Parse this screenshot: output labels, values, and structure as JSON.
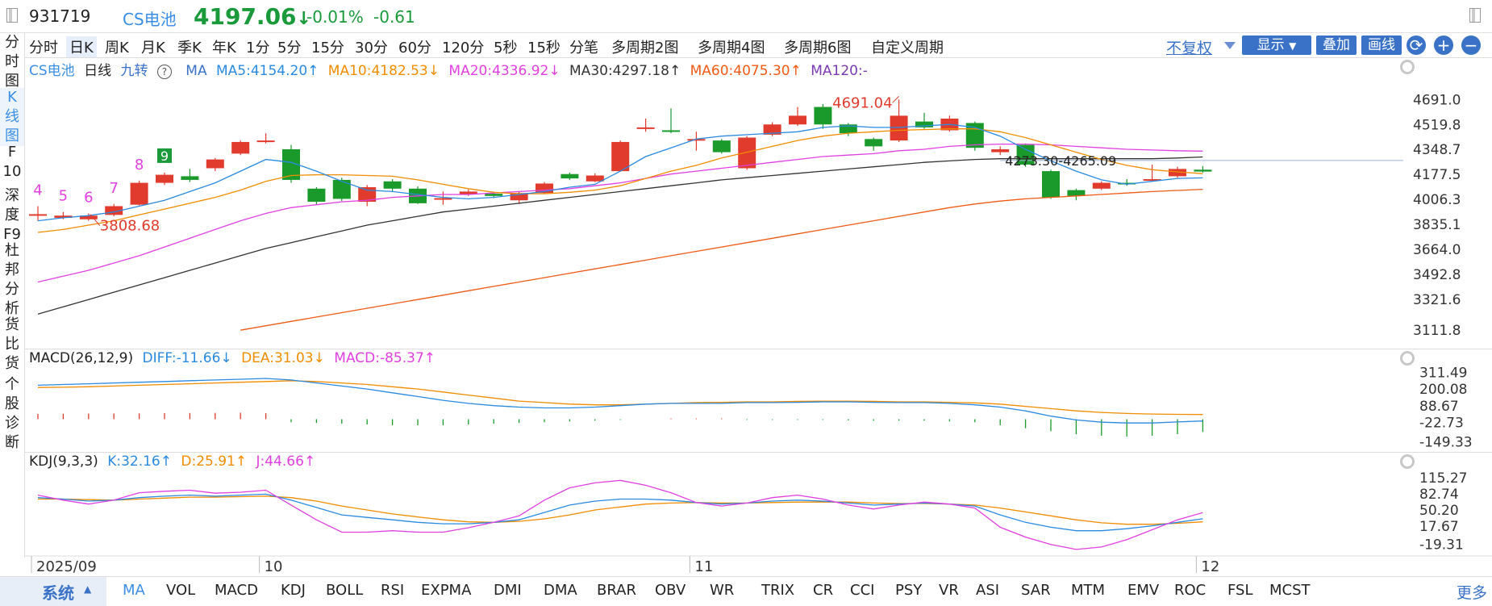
{
  "header": {
    "code": "931719",
    "name": "CS电池",
    "price": "4197.06",
    "change_pct": "-0.01%",
    "change_abs": "-0.61"
  },
  "left_nav": [
    {
      "label": "分时图",
      "active": false
    },
    {
      "label": "K线图",
      "active": true
    },
    {
      "label": "F10",
      "active": false
    },
    {
      "label": "深度F9",
      "active": false
    },
    {
      "label": "杜邦分析",
      "active": false
    },
    {
      "label": "货比货",
      "active": false
    },
    {
      "label": "个股诊断",
      "active": false
    }
  ],
  "periods": [
    "分时",
    "日K",
    "周K",
    "月K",
    "季K",
    "年K",
    "1分",
    "5分",
    "15分",
    "30分",
    "60分",
    "120分",
    "5秒",
    "15秒",
    "分笔",
    "多周期2图",
    "多周期4图",
    "多周期6图",
    "自定义周期"
  ],
  "active_period": "日K",
  "toolbar": {
    "adjust": "不复权",
    "display": "显示",
    "overlay": "叠加",
    "draw": "画线",
    "refresh_icon": "refresh-icon",
    "zoom_in": "+",
    "zoom_out": "−"
  },
  "main_legend": {
    "name": "CS电池",
    "period": "日线",
    "nine": "九转",
    "ma": "MA",
    "ma5": "MA5:4154.20↑",
    "ma10": "MA10:4182.53↓",
    "ma20": "MA20:4336.92↓",
    "ma30": "MA30:4297.18↑",
    "ma60": "MA60:4075.30↑",
    "ma120": "MA120:-"
  },
  "macd_legend": {
    "title": "MACD(26,12,9)",
    "diff": "DIFF:-11.66↓",
    "dea": "DEA:31.03↓",
    "macd": "MACD:-85.37↑"
  },
  "kdj_legend": {
    "title": "KDJ(9,3,3)",
    "k": "K:32.16↑",
    "d": "D:25.91↑",
    "j": "J:44.66↑"
  },
  "x_labels": [
    {
      "label": "2025/09",
      "index": 0
    },
    {
      "label": "10",
      "index": 9
    },
    {
      "label": "11",
      "index": 26
    },
    {
      "label": "12",
      "index": 46
    }
  ],
  "colors": {
    "up": "#e03b2c",
    "down": "#1a9a2a",
    "ma5": "#2a8ae0",
    "ma10": "#f08c00",
    "ma20": "#e040e0",
    "ma30": "#333333",
    "ma60": "#f05a14"
  },
  "chart_data": {
    "type": "candlestick",
    "main_y_ticks": [
      4691.0,
      4519.8,
      4348.7,
      4177.5,
      4006.3,
      3835.1,
      3664.0,
      3492.8,
      3321.6,
      3111.8
    ],
    "main_ylim": [
      3050,
      4820
    ],
    "candles": [
      [
        3905,
        3905,
        3960,
        3860
      ],
      [
        3880,
        3895,
        3920,
        3870
      ],
      [
        3870,
        3895,
        3910,
        3860
      ],
      [
        3900,
        3960,
        3975,
        3890
      ],
      [
        3970,
        4120,
        4135,
        3965
      ],
      [
        4120,
        4175,
        4190,
        4105
      ],
      [
        4165,
        4140,
        4215,
        4125
      ],
      [
        4220,
        4280,
        4290,
        4200
      ],
      [
        4320,
        4400,
        4410,
        4310
      ],
      [
        4400,
        4410,
        4460,
        4390
      ],
      [
        4350,
        4140,
        4380,
        4120
      ],
      [
        4080,
        3990,
        4090,
        3970
      ],
      [
        4140,
        4010,
        4155,
        3995
      ],
      [
        3990,
        4090,
        4105,
        3960
      ],
      [
        4130,
        4080,
        4145,
        4060
      ],
      [
        4080,
        3980,
        4095,
        3975
      ],
      [
        4015,
        4015,
        4060,
        3970
      ],
      [
        4040,
        4060,
        4075,
        4030
      ],
      [
        4045,
        4030,
        4060,
        4015
      ],
      [
        4000,
        4050,
        4060,
        3975
      ],
      [
        4050,
        4115,
        4125,
        4045
      ],
      [
        4180,
        4150,
        4190,
        4140
      ],
      [
        4130,
        4170,
        4185,
        4125
      ],
      [
        4200,
        4400,
        4410,
        4195
      ],
      [
        4500,
        4500,
        4560,
        4470
      ],
      [
        4480,
        4470,
        4630,
        4460
      ],
      [
        4420,
        4420,
        4470,
        4340
      ],
      [
        4410,
        4330,
        4420,
        4320
      ],
      [
        4220,
        4430,
        4440,
        4210
      ],
      [
        4450,
        4520,
        4535,
        4440
      ],
      [
        4520,
        4580,
        4640,
        4510
      ],
      [
        4640,
        4520,
        4660,
        4490
      ],
      [
        4520,
        4460,
        4530,
        4440
      ],
      [
        4420,
        4370,
        4430,
        4340
      ],
      [
        4410,
        4580,
        4691.04,
        4400
      ],
      [
        4540,
        4500,
        4600,
        4490
      ],
      [
        4480,
        4560,
        4580,
        4470
      ],
      [
        4530,
        4360,
        4540,
        4340
      ],
      [
        4330,
        4350,
        4370,
        4310
      ],
      [
        4380,
        4245,
        4390,
        4230
      ],
      [
        4200,
        4020,
        4210,
        4010
      ],
      [
        4070,
        4030,
        4080,
        4000
      ],
      [
        4080,
        4120,
        4130,
        4070
      ],
      [
        4120,
        4110,
        4145,
        4100
      ],
      [
        4145,
        4145,
        4245,
        4140
      ],
      [
        4165,
        4215,
        4230,
        4155
      ],
      [
        4210,
        4197.06,
        4235,
        4190
      ]
    ],
    "ma5": [
      3860,
      3880,
      3895,
      3920,
      3960,
      4000,
      4060,
      4120,
      4200,
      4280,
      4260,
      4200,
      4130,
      4070,
      4060,
      4040,
      4020,
      4010,
      4020,
      4040,
      4060,
      4090,
      4110,
      4200,
      4300,
      4360,
      4420,
      4440,
      4450,
      4460,
      4470,
      4500,
      4510,
      4500,
      4500,
      4510,
      4520,
      4500,
      4440,
      4350,
      4270,
      4200,
      4140,
      4110,
      4130,
      4150,
      4154.2
    ],
    "ma10": [
      3780,
      3800,
      3830,
      3860,
      3900,
      3940,
      3980,
      4020,
      4070,
      4130,
      4170,
      4175,
      4175,
      4170,
      4165,
      4140,
      4110,
      4080,
      4055,
      4045,
      4045,
      4055,
      4070,
      4100,
      4150,
      4200,
      4240,
      4290,
      4330,
      4370,
      4410,
      4440,
      4460,
      4470,
      4480,
      4485,
      4490,
      4490,
      4470,
      4430,
      4380,
      4330,
      4280,
      4240,
      4210,
      4195,
      4182.53
    ],
    "ma20": [
      3440,
      3480,
      3520,
      3570,
      3620,
      3680,
      3740,
      3800,
      3860,
      3910,
      3950,
      3970,
      3990,
      4000,
      4020,
      4030,
      4040,
      4040,
      4050,
      4060,
      4070,
      4080,
      4100,
      4120,
      4150,
      4180,
      4200,
      4220,
      4240,
      4260,
      4280,
      4300,
      4310,
      4320,
      4340,
      4350,
      4370,
      4380,
      4385,
      4385,
      4380,
      4370,
      4360,
      4350,
      4345,
      4340,
      4336.92
    ],
    "ma30": [
      3220,
      3270,
      3320,
      3370,
      3420,
      3470,
      3520,
      3570,
      3620,
      3670,
      3710,
      3750,
      3790,
      3830,
      3860,
      3890,
      3920,
      3940,
      3960,
      3980,
      4000,
      4020,
      4040,
      4060,
      4080,
      4100,
      4120,
      4140,
      4155,
      4170,
      4185,
      4200,
      4215,
      4230,
      4245,
      4260,
      4270,
      4280,
      4285,
      4285,
      4285,
      4285,
      4285,
      4285,
      4285,
      4290,
      4297.18
    ],
    "ma60": [
      null,
      null,
      null,
      null,
      null,
      null,
      null,
      null,
      3110,
      3140,
      3170,
      3200,
      3230,
      3260,
      3290,
      3320,
      3350,
      3380,
      3410,
      3440,
      3470,
      3500,
      3530,
      3560,
      3590,
      3620,
      3650,
      3680,
      3710,
      3740,
      3770,
      3800,
      3830,
      3860,
      3890,
      3920,
      3950,
      3975,
      3995,
      4010,
      4020,
      4030,
      4040,
      4050,
      4060,
      4068,
      4075.3
    ],
    "annotations": {
      "low": {
        "index": 2,
        "value": "3808.68"
      },
      "high": {
        "index": 34,
        "value": "4691.04"
      },
      "range": "4273.30-4265.09",
      "td_counts": [
        {
          "index": 0,
          "label": "4"
        },
        {
          "index": 1,
          "label": "5"
        },
        {
          "index": 2,
          "label": "6"
        },
        {
          "index": 3,
          "label": "7"
        },
        {
          "index": 4,
          "label": "8"
        },
        {
          "index": 5,
          "label": "9"
        }
      ]
    },
    "macd": {
      "y_ticks": [
        311.49,
        200.08,
        88.67,
        -22.73,
        -149.33
      ],
      "ylim": [
        -190,
        345
      ],
      "diff": [
        225,
        230,
        235,
        240,
        245,
        250,
        255,
        260,
        265,
        270,
        260,
        240,
        220,
        200,
        175,
        150,
        125,
        105,
        90,
        80,
        75,
        75,
        80,
        90,
        100,
        105,
        105,
        105,
        110,
        110,
        112,
        115,
        115,
        112,
        110,
        110,
        105,
        95,
        80,
        55,
        20,
        -5,
        -20,
        -25,
        -25,
        -18,
        -11.66
      ],
      "dea": [
        210,
        212,
        215,
        220,
        225,
        230,
        235,
        240,
        245,
        250,
        255,
        250,
        240,
        230,
        215,
        200,
        180,
        160,
        140,
        120,
        110,
        100,
        95,
        95,
        100,
        105,
        110,
        112,
        115,
        115,
        118,
        120,
        120,
        118,
        115,
        115,
        112,
        108,
        100,
        85,
        70,
        55,
        45,
        38,
        34,
        32,
        31.03
      ],
      "hist": [
        35,
        36,
        37,
        38,
        39,
        40,
        41,
        42,
        43,
        40,
        -20,
        -25,
        -30,
        -35,
        -40,
        -40,
        -40,
        -35,
        -30,
        -25,
        -20,
        -15,
        -10,
        -5,
        0,
        5,
        5,
        5,
        -5,
        -5,
        -5,
        -5,
        -8,
        -10,
        -10,
        -10,
        -15,
        -20,
        -40,
        -60,
        -80,
        -100,
        -110,
        -115,
        -110,
        -100,
        -85.37
      ]
    },
    "kdj": {
      "y_ticks": [
        115.27,
        82.74,
        50.2,
        17.67,
        -19.31
      ],
      "ylim": [
        -35,
        135
      ],
      "k": [
        75,
        72,
        68,
        70,
        75,
        78,
        80,
        78,
        80,
        82,
        70,
        55,
        40,
        35,
        30,
        25,
        22,
        22,
        25,
        30,
        45,
        60,
        68,
        72,
        72,
        70,
        65,
        62,
        64,
        68,
        70,
        68,
        64,
        60,
        62,
        64,
        62,
        58,
        40,
        25,
        15,
        8,
        8,
        12,
        18,
        25,
        32.16
      ],
      "d": [
        72,
        72,
        71,
        70,
        72,
        74,
        76,
        76,
        77,
        78,
        75,
        68,
        58,
        50,
        42,
        36,
        30,
        26,
        25,
        27,
        32,
        40,
        50,
        56,
        62,
        64,
        65,
        64,
        64,
        65,
        66,
        66,
        66,
        64,
        63,
        63,
        62,
        60,
        54,
        46,
        38,
        30,
        24,
        21,
        21,
        23,
        25.91
      ],
      "j": [
        80,
        70,
        62,
        70,
        85,
        88,
        90,
        84,
        86,
        90,
        60,
        30,
        5,
        5,
        8,
        5,
        5,
        14,
        25,
        38,
        70,
        95,
        105,
        110,
        100,
        85,
        65,
        58,
        64,
        75,
        80,
        72,
        60,
        52,
        60,
        66,
        62,
        54,
        15,
        -5,
        -20,
        -30,
        -25,
        -10,
        10,
        30,
        44.66
      ]
    }
  }
}
